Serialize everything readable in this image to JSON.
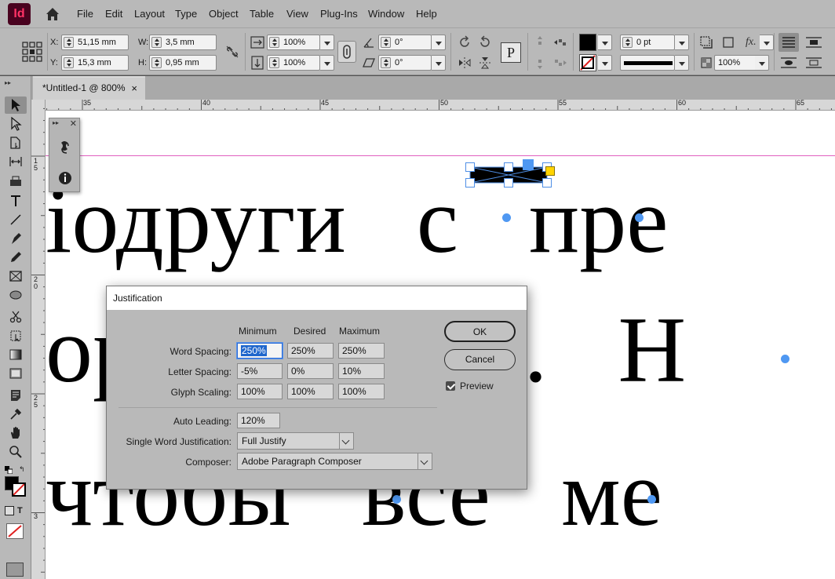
{
  "app": {
    "logo_text": "Id"
  },
  "menu": [
    "File",
    "Edit",
    "Layout",
    "Type",
    "Object",
    "Table",
    "View",
    "Plug-Ins",
    "Window",
    "Help"
  ],
  "control_panel": {
    "x_label": "X:",
    "x_value": "51,15 mm",
    "y_label": "Y:",
    "y_value": "15,3 mm",
    "w_label": "W:",
    "w_value": "3,5 mm",
    "h_label": "H:",
    "h_value": "0,95 mm",
    "scale_x": "100%",
    "scale_y": "100%",
    "rotate": "0°",
    "shear": "0°",
    "stroke_weight": "0 pt",
    "opacity": "100%",
    "fx_label": "fx.",
    "text_frame_icon": "P"
  },
  "document_tab": {
    "title": "*Untitled-1 @ 800%",
    "close": "×"
  },
  "ruler": {
    "h_ticks": [
      "35",
      "40",
      "45",
      "50",
      "55",
      "60",
      "65"
    ],
    "v_ticks": [
      [
        "1",
        "5"
      ],
      [
        "2",
        "0"
      ],
      [
        "2",
        "5"
      ],
      [
        "3"
      ]
    ]
  },
  "canvas": {
    "line1": "іодруги   с   пре",
    "line2": "ор        Шин.   Н",
    "line3": "чтобы   все   ме"
  },
  "dialog": {
    "title": "Justification",
    "col_min": "Minimum",
    "col_desired": "Desired",
    "col_max": "Maximum",
    "rows": [
      {
        "label": "Word Spacing:",
        "min": "250%",
        "desired": "250%",
        "max": "250%"
      },
      {
        "label": "Letter Spacing:",
        "min": "-5%",
        "desired": "0%",
        "max": "10%"
      },
      {
        "label": "Glyph Scaling:",
        "min": "100%",
        "desired": "100%",
        "max": "100%"
      }
    ],
    "auto_leading_label": "Auto Leading:",
    "auto_leading_value": "120%",
    "single_word_label": "Single Word Justification:",
    "single_word_value": "Full Justify",
    "composer_label": "Composer:",
    "composer_value": "Adobe Paragraph Composer",
    "ok": "OK",
    "cancel": "Cancel",
    "preview_label": "Preview",
    "preview_checked": true
  },
  "colors": {
    "accent": "#4f98f2",
    "guide": "#e060c0",
    "frame_fill": "#000000",
    "highlight": "#1f66cc"
  }
}
